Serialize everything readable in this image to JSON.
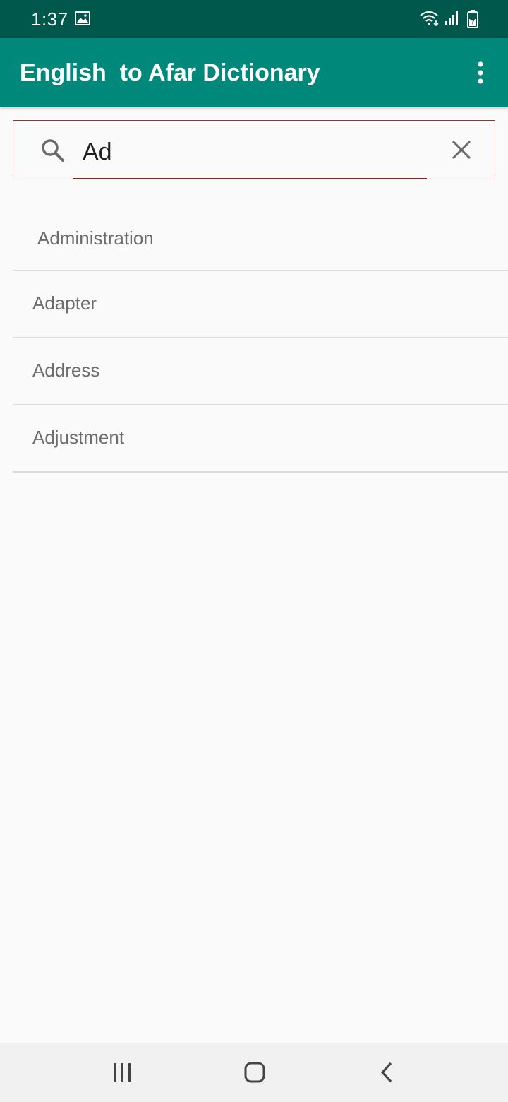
{
  "status_bar": {
    "time": "1:37",
    "icons": [
      "gallery-icon",
      "wifi-icon",
      "signal-icon",
      "battery-charging-icon"
    ]
  },
  "app_bar": {
    "title": "English  to Afar Dictionary",
    "menu_icon": "more-vert-icon",
    "color": "#00897b"
  },
  "search": {
    "value": "Ad",
    "search_icon": "search-icon",
    "clear_icon": "close-icon"
  },
  "results": [
    {
      "label": "Administration"
    },
    {
      "label": "Adapter"
    },
    {
      "label": "Address"
    },
    {
      "label": "Adjustment"
    }
  ],
  "nav_bar": {
    "buttons": [
      "recent-apps-icon",
      "home-icon",
      "back-icon"
    ]
  },
  "colors": {
    "status_bar": "#00574b",
    "app_bar": "#00897b",
    "search_border": "#8b3a32",
    "result_text": "#6d6d6d"
  }
}
